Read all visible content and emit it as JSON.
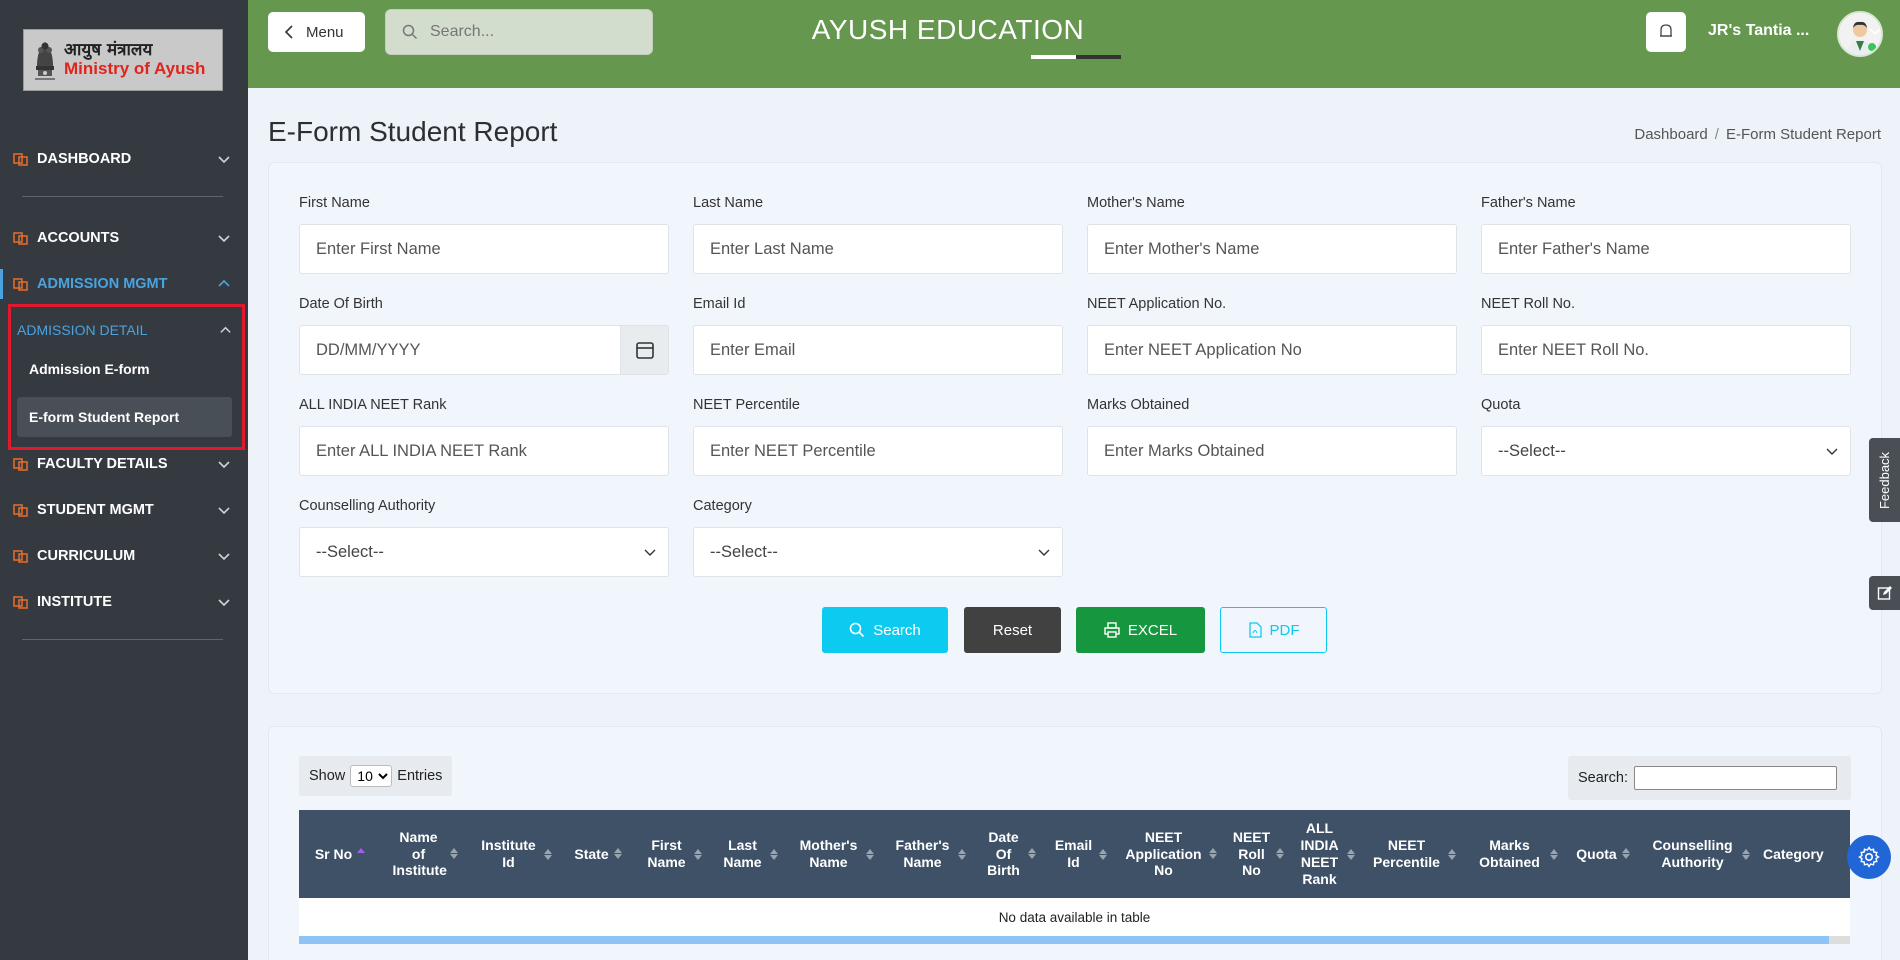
{
  "logo": {
    "hindi": "आयुष मंत्रालय",
    "english": "Ministry of Ayush"
  },
  "sidebar": {
    "items": [
      {
        "label": "DASHBOARD"
      },
      {
        "label": "ACCOUNTS"
      },
      {
        "label": "ADMISSION MGMT"
      },
      {
        "label": "FACULTY DETAILS"
      },
      {
        "label": "STUDENT MGMT"
      },
      {
        "label": "CURRICULUM"
      },
      {
        "label": "INSTITUTE"
      }
    ],
    "submenu": {
      "header": "ADMISSION DETAIL",
      "links": [
        {
          "label": "Admission E-form"
        },
        {
          "label": "E-form Student Report"
        }
      ]
    }
  },
  "topbar": {
    "menu_label": "Menu",
    "search_placeholder": "Search...",
    "app_title": "AYUSH EDUCATION",
    "user_name": "JR's Tantia ..."
  },
  "page": {
    "title": "E-Form Student Report",
    "breadcrumb": {
      "home": "Dashboard",
      "current": "E-Form Student Report"
    }
  },
  "form": {
    "first_name": {
      "label": "First Name",
      "placeholder": "Enter First Name"
    },
    "last_name": {
      "label": "Last Name",
      "placeholder": "Enter Last Name"
    },
    "mother_name": {
      "label": "Mother's Name",
      "placeholder": "Enter Mother's Name"
    },
    "father_name": {
      "label": "Father's Name",
      "placeholder": "Enter Father's Name"
    },
    "dob": {
      "label": "Date Of Birth",
      "placeholder": "DD/MM/YYYY"
    },
    "email": {
      "label": "Email Id",
      "placeholder": "Enter Email"
    },
    "neet_app": {
      "label": "NEET Application No.",
      "placeholder": "Enter NEET Application No"
    },
    "neet_roll": {
      "label": "NEET Roll No.",
      "placeholder": "Enter NEET Roll No."
    },
    "neet_rank": {
      "label": "ALL INDIA NEET Rank",
      "placeholder": "Enter ALL INDIA NEET Rank"
    },
    "neet_percentile": {
      "label": "NEET Percentile",
      "placeholder": "Enter NEET Percentile"
    },
    "marks": {
      "label": "Marks Obtained",
      "placeholder": "Enter Marks Obtained"
    },
    "quota": {
      "label": "Quota",
      "value": "--Select--"
    },
    "counselling": {
      "label": "Counselling Authority",
      "value": "--Select--"
    },
    "category": {
      "label": "Category",
      "value": "--Select--"
    },
    "buttons": {
      "search": "Search",
      "reset": "Reset",
      "excel": "EXCEL",
      "pdf": "PDF"
    }
  },
  "table": {
    "show_label": "Show",
    "entries_value": "10",
    "entries_label": "Entries",
    "search_label": "Search:",
    "columns": [
      "Sr No",
      "Name of Institute",
      "Institute Id",
      "State",
      "First Name",
      "Last Name",
      "Mother's Name",
      "Father's Name",
      "Date Of Birth",
      "Email Id",
      "NEET Application No",
      "NEET Roll No",
      "ALL INDIA NEET Rank",
      "NEET Percentile",
      "Marks Obtained",
      "Quota",
      "Counselling Authority",
      "Category"
    ],
    "empty_text": "No data available in table"
  },
  "floating": {
    "feedback": "Feedback"
  },
  "colors": {
    "sidebar_bg": "#343a40",
    "topbar_bg": "#65974f",
    "accent": "#4aa3df",
    "highlight": "#e0192c"
  }
}
